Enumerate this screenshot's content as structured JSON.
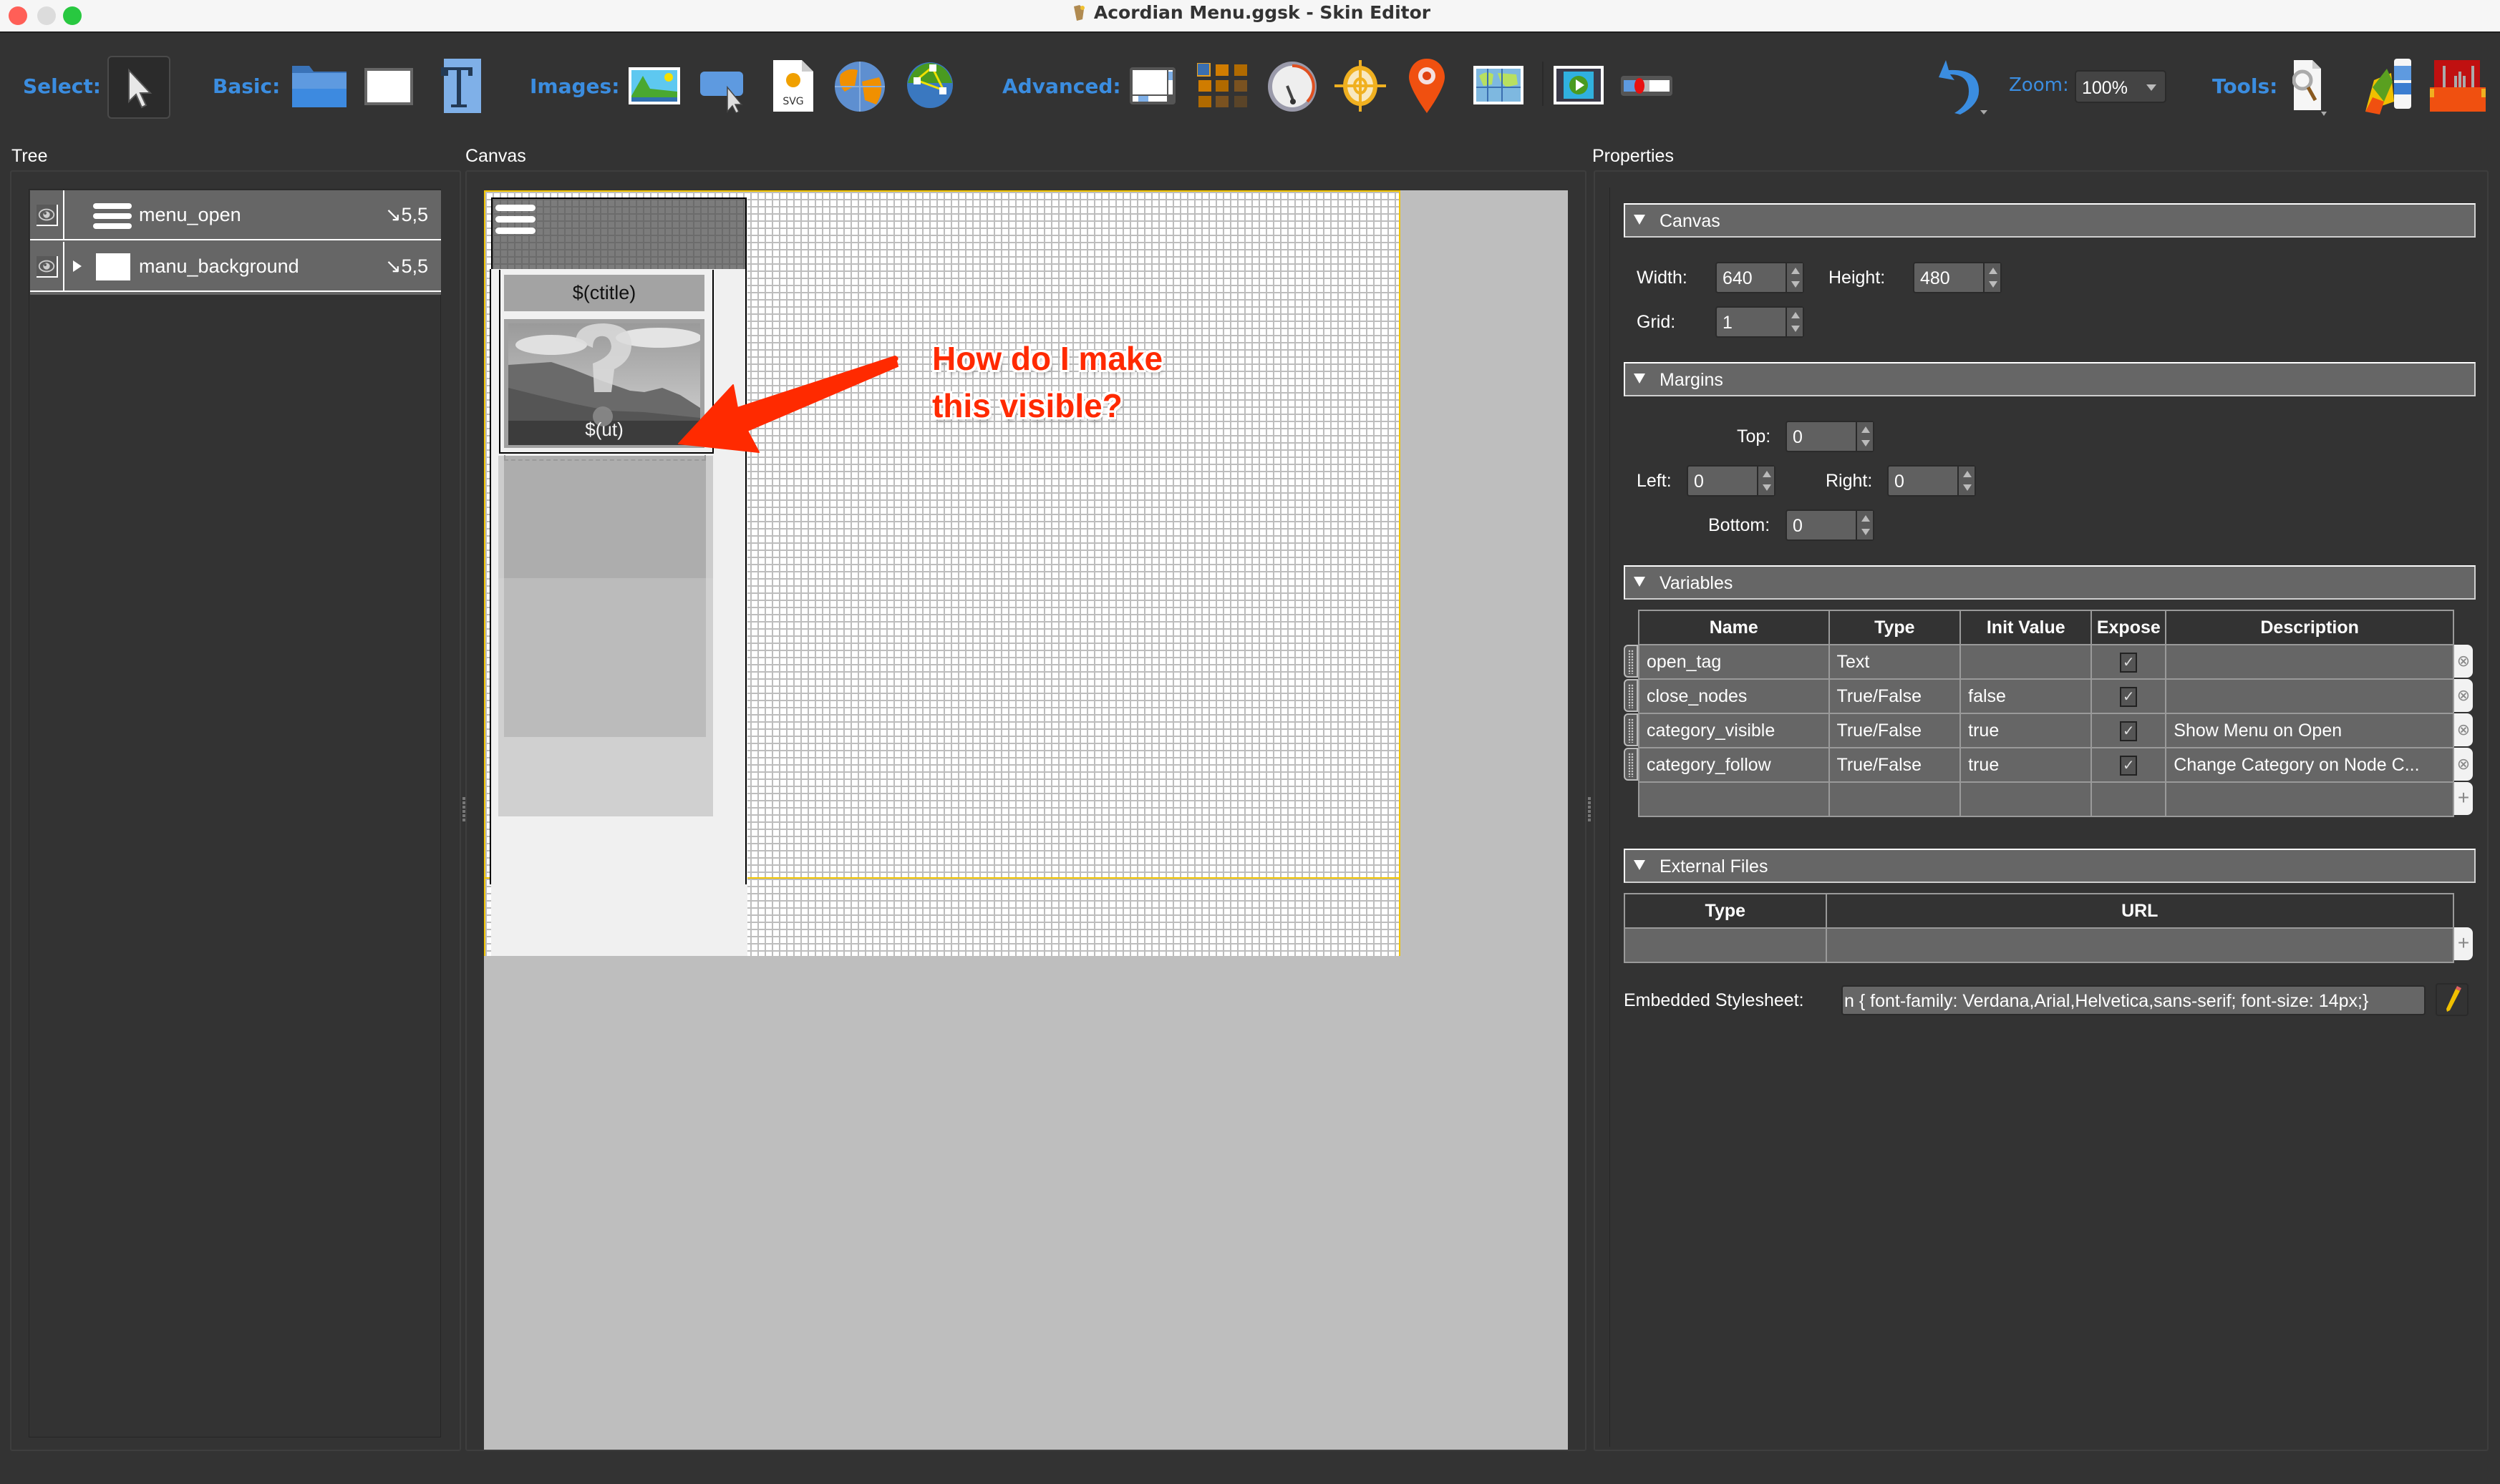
{
  "window": {
    "title": "Acordian Menu.ggsk - Skin Editor",
    "traffic_lights": {
      "close": "#ff5f57",
      "minimize": "#dcdcdc",
      "zoom": "#28c840"
    }
  },
  "toolbar": {
    "select_label": "Select:",
    "basic_label": "Basic:",
    "images_label": "Images:",
    "advanced_label": "Advanced:",
    "zoom_label": "Zoom:",
    "zoom_value": "100%",
    "tools_label": "Tools:",
    "accent_color": "#3b8de0",
    "select_tools": [
      {
        "icon": "pointer-icon"
      }
    ],
    "basic_tools": [
      {
        "icon": "container-icon"
      },
      {
        "icon": "rectangle-icon"
      },
      {
        "icon": "text-icon"
      }
    ],
    "image_tools": [
      {
        "icon": "image-icon"
      },
      {
        "icon": "button-icon"
      },
      {
        "icon": "svg-icon"
      },
      {
        "icon": "hotspot-globe-icon"
      },
      {
        "icon": "polygon-hotspot-icon"
      }
    ],
    "advanced_tools": [
      {
        "icon": "scroll-area-icon"
      },
      {
        "icon": "cloner-icon"
      },
      {
        "icon": "timer-icon"
      },
      {
        "icon": "crosshair-icon"
      },
      {
        "icon": "map-pin-icon"
      },
      {
        "icon": "map-icon"
      },
      {
        "icon": "video-icon"
      },
      {
        "icon": "toggle-icon"
      }
    ],
    "undo_icon": "undo-icon",
    "tool_icons": [
      {
        "icon": "inspect-file-icon"
      },
      {
        "icon": "color-palette-icon"
      },
      {
        "icon": "toolbox-icon"
      }
    ]
  },
  "panels": {
    "tree_label": "Tree",
    "canvas_label": "Canvas",
    "properties_label": "Properties"
  },
  "tree": {
    "items": [
      {
        "name": "menu_open",
        "position": "↘5,5",
        "icon": "hamburger-icon",
        "expandable": false
      },
      {
        "name": "manu_background",
        "position": "↘5,5",
        "icon": "rectangle-icon",
        "expandable": true
      }
    ]
  },
  "canvas": {
    "category_title": "$(ctitle)",
    "node_label": "$(ut)",
    "annotation": {
      "line1": "How do I make",
      "line2": "this visible?",
      "color": "#ff2a00"
    }
  },
  "properties": {
    "canvas_section": {
      "title": "Canvas",
      "width_label": "Width:",
      "width": "640",
      "height_label": "Height:",
      "height": "480",
      "grid_label": "Grid:",
      "grid": "1"
    },
    "margins_section": {
      "title": "Margins",
      "top_label": "Top:",
      "top": "0",
      "left_label": "Left:",
      "left": "0",
      "right_label": "Right:",
      "right": "0",
      "bottom_label": "Bottom:",
      "bottom": "0"
    },
    "variables_section": {
      "title": "Variables",
      "columns": [
        "Name",
        "Type",
        "Init Value",
        "Expose",
        "Description"
      ],
      "rows": [
        {
          "name": "open_tag",
          "type": "Text",
          "init": "",
          "expose": true,
          "description": ""
        },
        {
          "name": "close_nodes",
          "type": "True/False",
          "init": "false",
          "expose": true,
          "description": ""
        },
        {
          "name": "category_visible",
          "type": "True/False",
          "init": "true",
          "expose": true,
          "description": "Show Menu on Open"
        },
        {
          "name": "category_follow",
          "type": "True/False",
          "init": "true",
          "expose": true,
          "description": "Change Category on Node C..."
        }
      ]
    },
    "external_files_section": {
      "title": "External Files",
      "columns": [
        "Type",
        "URL"
      ]
    },
    "stylesheet_label": "Embedded Stylesheet:",
    "stylesheet_value": "n { font-family: Verdana,Arial,Helvetica,sans-serif; font-size: 14px;}"
  }
}
